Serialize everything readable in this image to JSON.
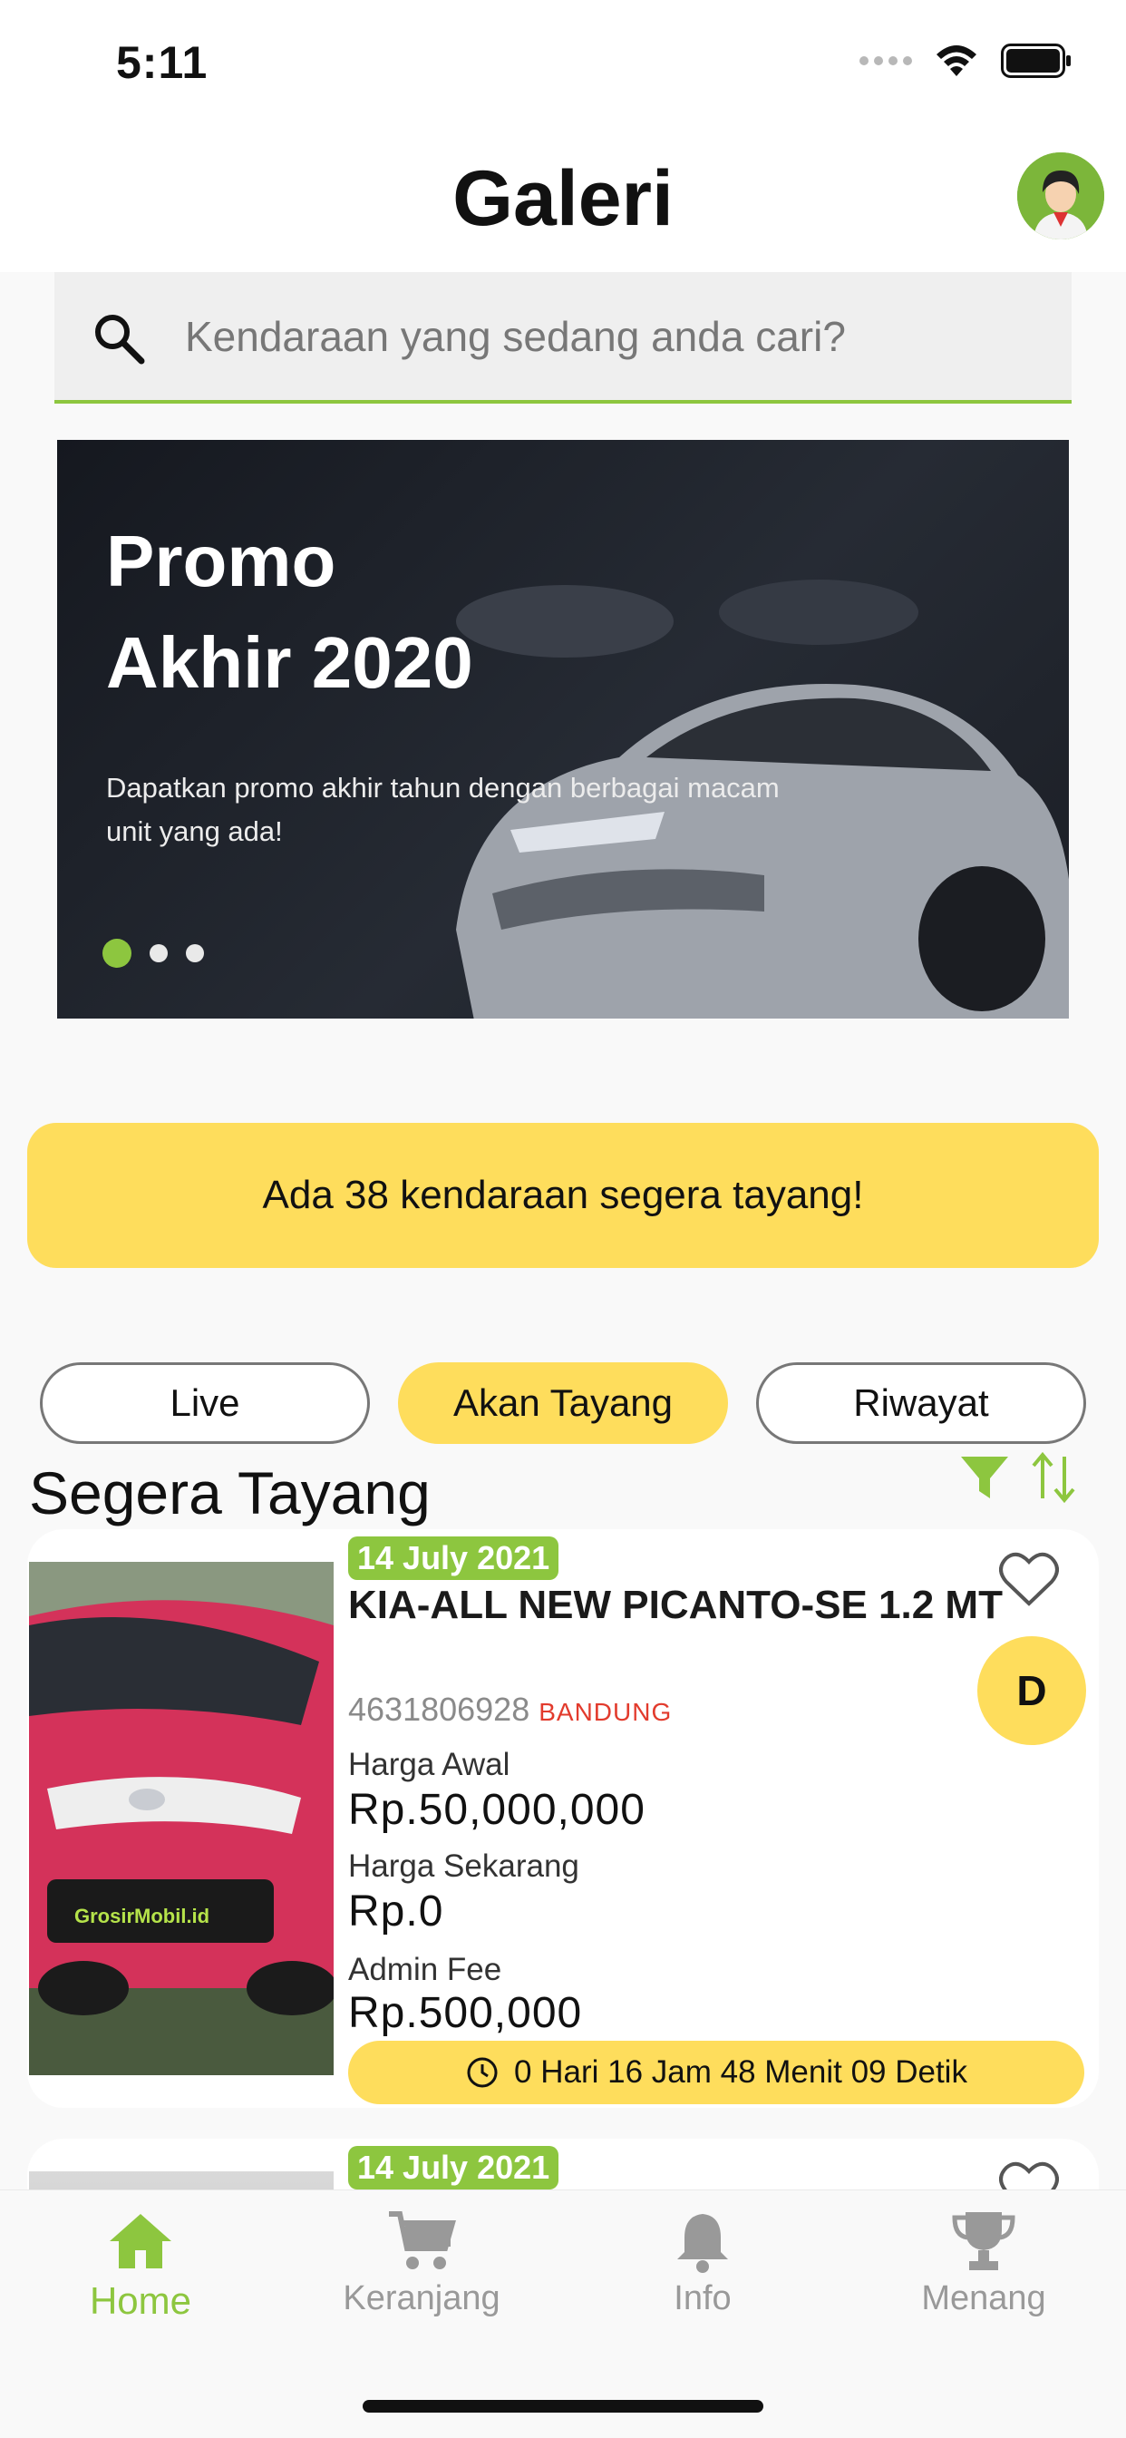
{
  "status_bar": {
    "time": "5:11"
  },
  "header": {
    "title": "Galeri"
  },
  "search": {
    "placeholder": "Kendaraan yang sedang anda cari?"
  },
  "banner": {
    "title_line1": "Promo",
    "title_line2": "Akhir 2020",
    "description": "Dapatkan promo akhir tahun dengan berbagai macam unit yang ada!",
    "slide_count": 3,
    "active_slide": 1
  },
  "notice": {
    "text": "Ada 38 kendaraan segera tayang!"
  },
  "tabs": [
    {
      "label": "Live"
    },
    {
      "label": "Akan Tayang"
    },
    {
      "label": "Riwayat"
    }
  ],
  "active_tab": 1,
  "section": {
    "title": "Segera Tayang"
  },
  "listings": [
    {
      "date": "14 July 2021",
      "title": "KIA-ALL NEW PICANTO-SE 1.2 MT",
      "id": "4631806928",
      "location": "BANDUNG",
      "grade": "D",
      "harga_awal_label": "Harga Awal",
      "harga_awal": "Rp.50,000,000",
      "harga_sekarang_label": "Harga Sekarang",
      "harga_sekarang": "Rp.0",
      "admin_fee_label": "Admin Fee",
      "admin_fee": "Rp.500,000",
      "countdown": "0 Hari 16 Jam 48 Menit 09 Detik",
      "image_watermark": "GrosirMobil.id"
    },
    {
      "date": "14 July 2021"
    }
  ],
  "bottom_nav": [
    {
      "label": "Home",
      "icon": "home-icon"
    },
    {
      "label": "Keranjang",
      "icon": "cart-icon"
    },
    {
      "label": "Info",
      "icon": "bell-icon"
    },
    {
      "label": "Menang",
      "icon": "trophy-icon"
    }
  ],
  "active_nav": 0,
  "colors": {
    "accent_green": "#8dc63f",
    "accent_yellow": "#fedd5c",
    "location_red": "#e23b2d"
  }
}
